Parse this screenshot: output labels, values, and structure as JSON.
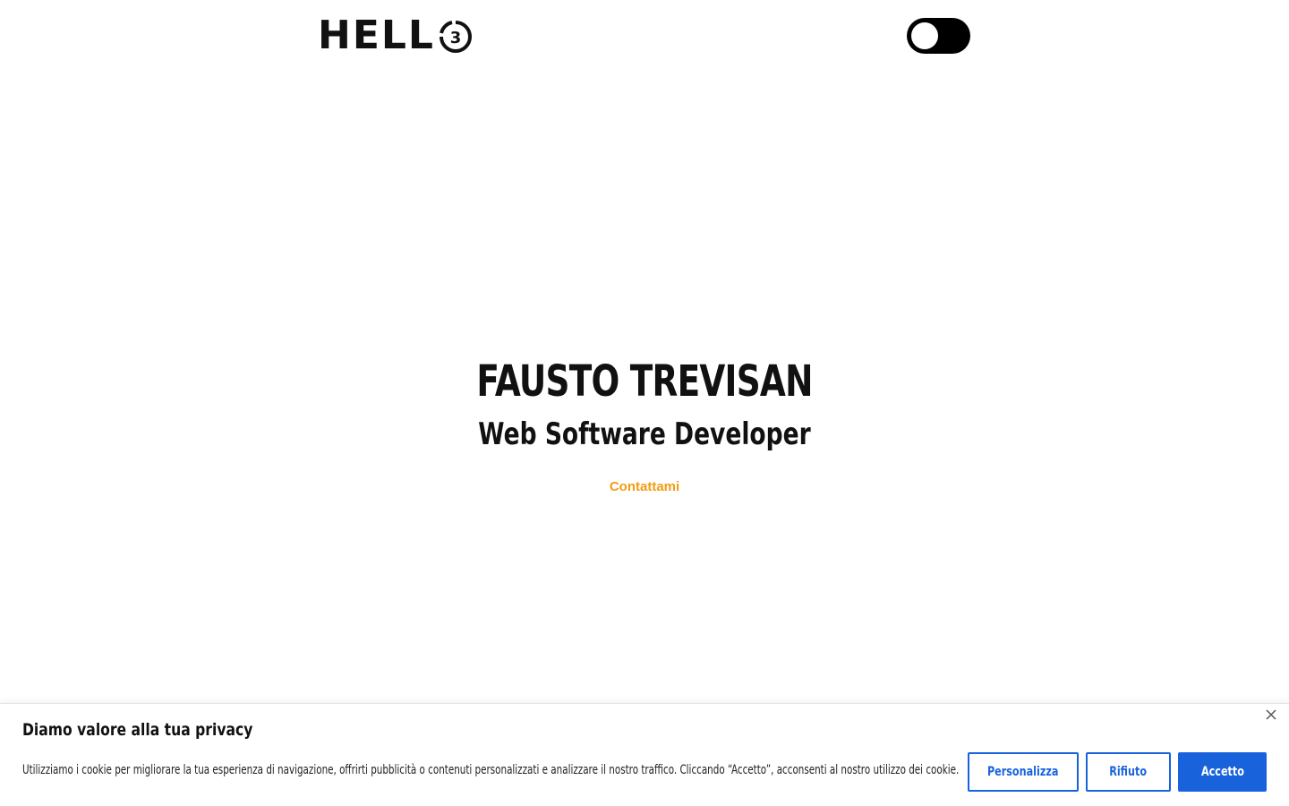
{
  "header": {
    "logo_text": "HELL",
    "logo_digit": "3",
    "theme_toggle_label": ""
  },
  "hero": {
    "name": "FAUSTO TREVISAN",
    "role": "Web Software Developer",
    "cta_label": "Contattami"
  },
  "cookie_banner": {
    "title": "Diamo valore alla tua privacy",
    "text": "Utilizziamo i cookie per migliorare la tua esperienza di navigazione, offrirti pubblicità o contenuti personalizzati e analizzare il nostro traffico. Cliccando “Accetto”, acconsenti al nostro utilizzo dei cookie.",
    "customize_label": "Personalizza",
    "reject_label": "Rifiuto",
    "accept_label": "Accetto",
    "accent_color": "#1863dc"
  },
  "colors": {
    "cta": "#f29c11",
    "toggle_bg": "#000000"
  },
  "icons": {
    "close": "close-icon",
    "logo_circle": "logo-circle-icon"
  }
}
